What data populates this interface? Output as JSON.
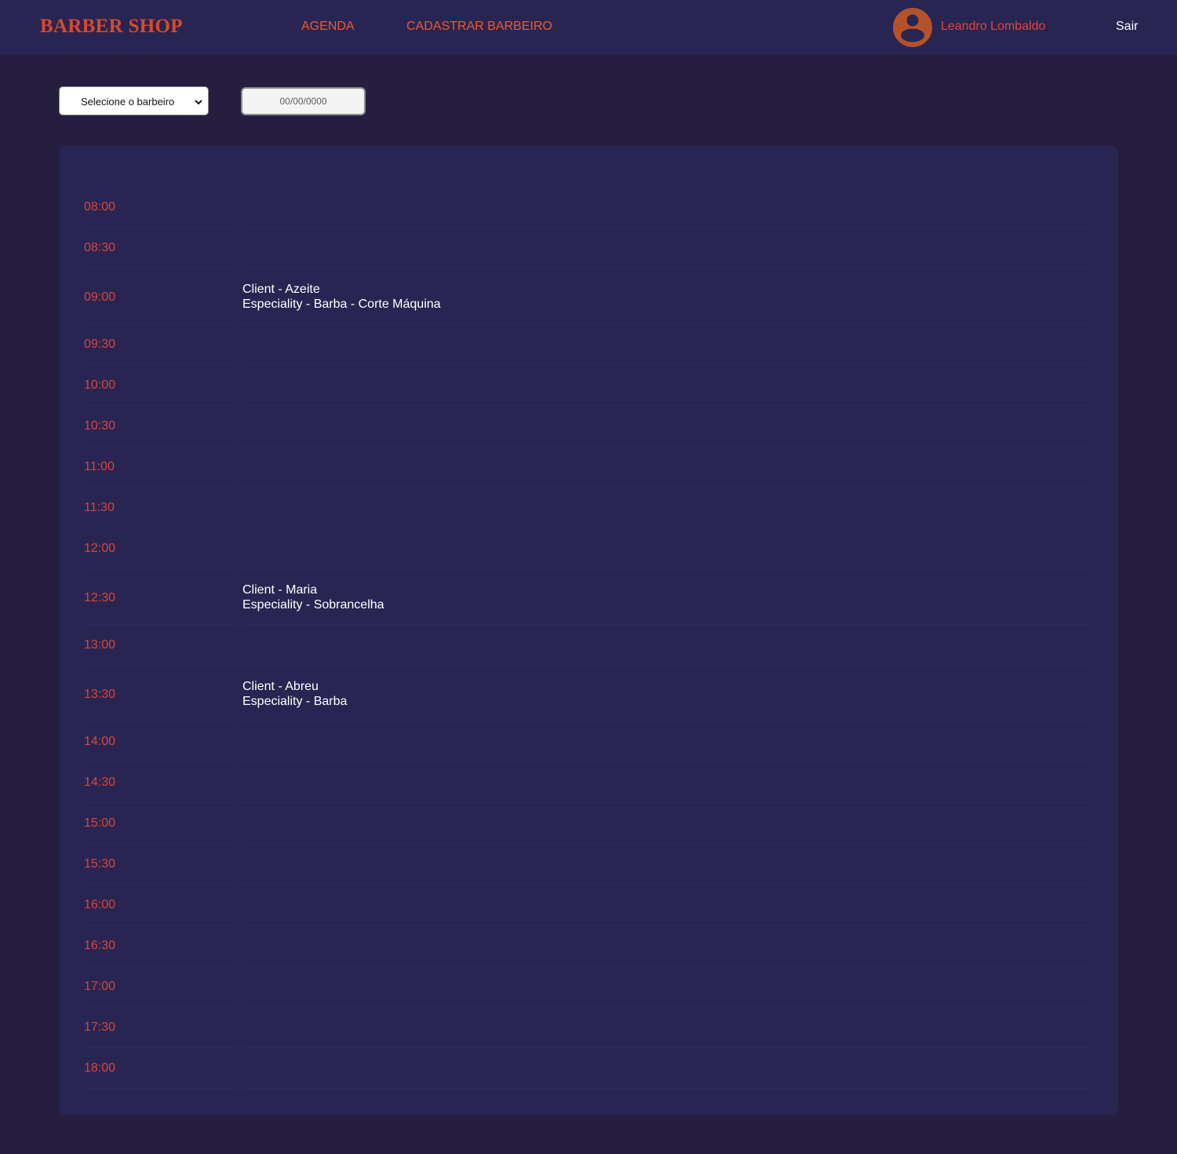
{
  "header": {
    "brand": "BARBER SHOP",
    "nav": [
      "AGENDA",
      "CADASTRAR BARBEIRO"
    ],
    "user_name": "Leandro Lombaldo",
    "avatar_icon": "user-circle-icon",
    "logout_label": "Sair"
  },
  "filters": {
    "barber_select_value": "Selecione o barbeiro",
    "date_placeholder": "00/00/0000"
  },
  "schedule": {
    "slots": [
      {
        "time": "08:00"
      },
      {
        "time": "08:30"
      },
      {
        "time": "09:00",
        "client": "Client - Azeite",
        "speciality": "Especiality - Barba - Corte Máquina"
      },
      {
        "time": "09:30"
      },
      {
        "time": "10:00"
      },
      {
        "time": "10:30"
      },
      {
        "time": "11:00"
      },
      {
        "time": "11:30"
      },
      {
        "time": "12:00"
      },
      {
        "time": "12:30",
        "client": "Client - Maria",
        "speciality": "Especiality - Sobrancelha"
      },
      {
        "time": "13:00"
      },
      {
        "time": "13:30",
        "client": "Client - Abreu",
        "speciality": "Especiality - Barba"
      },
      {
        "time": "14:00"
      },
      {
        "time": "14:30"
      },
      {
        "time": "15:00"
      },
      {
        "time": "15:30"
      },
      {
        "time": "16:00"
      },
      {
        "time": "16:30"
      },
      {
        "time": "17:00"
      },
      {
        "time": "17:30"
      },
      {
        "time": "18:00"
      }
    ]
  },
  "colors": {
    "background": "#251e3e",
    "panel": "#292552",
    "accent": "#f0582b",
    "time_text": "#d9443a",
    "avatar": "#b4522c"
  }
}
